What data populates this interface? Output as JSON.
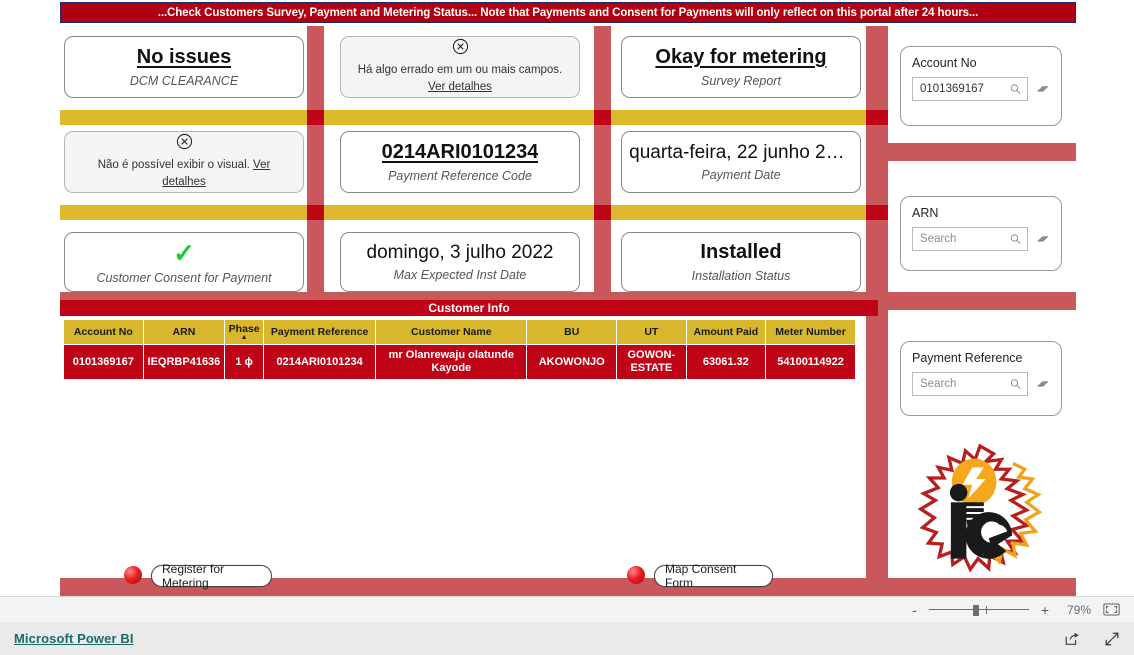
{
  "banner": {
    "text": "...Check Customers Survey, Payment and Metering Status... Note that Payments and Consent for Payments will only reflect on this portal after 24 hours..."
  },
  "cards": {
    "dcm_clearance": {
      "value": "No issues",
      "label": "DCM CLEARANCE"
    },
    "survey_report": {
      "value": "Okay for metering",
      "label": "Survey Report"
    },
    "payment_ref_code": {
      "value": "0214ARI0101234",
      "label": "Payment Reference Code"
    },
    "payment_date": {
      "value": "quarta-feira, 22 junho 20…",
      "label": "Payment Date"
    },
    "consent": {
      "value": "✓",
      "label": "Customer Consent for Payment"
    },
    "max_inst_date": {
      "value": "domingo, 3 julho 2022",
      "label": "Max Expected Inst Date"
    },
    "install_status": {
      "value": "Installed",
      "label": "Installation Status"
    }
  },
  "errors": {
    "field_error": {
      "text": "Há algo errado em um ou mais campos. ",
      "link": "Ver detalhes"
    },
    "visual_error": {
      "text": "Não é possível exibir o visual. ",
      "link": "Ver detalhes"
    }
  },
  "table": {
    "title": "Customer Info",
    "columns": [
      "Account No",
      "ARN",
      "Phase",
      "Payment Reference",
      "Customer Name",
      "BU",
      "UT",
      "Amount Paid",
      "Meter Number"
    ],
    "sorted_column": "Phase",
    "rows": [
      [
        "0101369167",
        "IEQRBP41636",
        "1 ɸ",
        "0214ARI0101234",
        "mr Olanrewaju olatunde Kayode",
        "AKOWONJO",
        "GOWON-ESTATE",
        "63061.32",
        "54100114922"
      ]
    ]
  },
  "slicers": [
    {
      "title": "Account No",
      "value": "0101369167",
      "placeholder": "Search"
    },
    {
      "title": "ARN",
      "value": "",
      "placeholder": "Search"
    },
    {
      "title": "Payment Reference",
      "value": "",
      "placeholder": "Search"
    }
  ],
  "buttons": {
    "register": "Register for Metering",
    "map_consent": "Map Consent Form"
  },
  "logo": {
    "text": "ie",
    "alt": "ikeja-electric-logo"
  },
  "statusbar": {
    "zoom_minus": "-",
    "zoom_plus": "+",
    "zoom_level": "79%"
  },
  "appbar": {
    "brand": "Microsoft Power BI"
  },
  "colors": {
    "brand_red": "#c00418",
    "bar_red": "#c8585c",
    "gold": "#ddb92e",
    "banner_red": "#b00012",
    "consent_green": "#19d12a",
    "powerbi_teal": "#1b6b6b"
  }
}
